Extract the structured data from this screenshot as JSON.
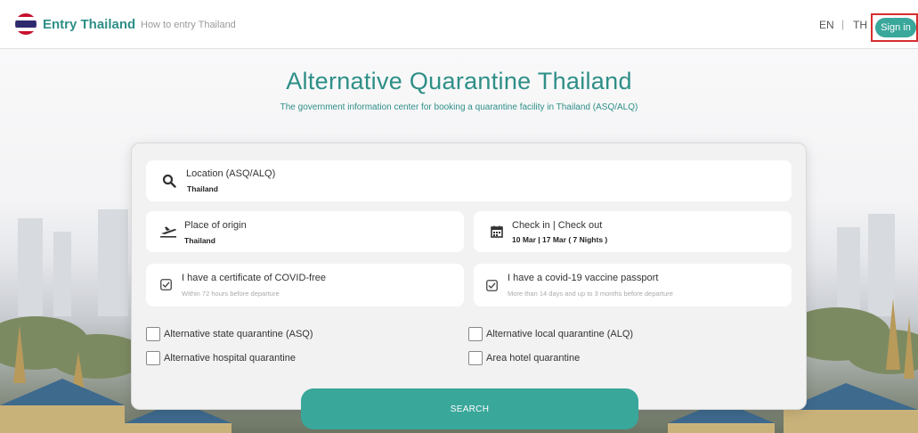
{
  "header": {
    "brand": "Entry Thailand",
    "tagline": "How to entry Thailand",
    "lang_en": "EN",
    "lang_sep": "|",
    "lang_th": "TH",
    "signin_label": "Sign in"
  },
  "hero": {
    "title": "Alternative Quarantine Thailand",
    "subtitle": "The government information center for booking a quarantine facility in Thailand (ASQ/ALQ)"
  },
  "form": {
    "location": {
      "label": "Location (ASQ/ALQ)",
      "value": "Thailand",
      "icon": "search-icon"
    },
    "origin": {
      "label": "Place of origin",
      "value": "Thailand",
      "icon": "plane-departure-icon"
    },
    "dates": {
      "label": "Check in | Check out",
      "value": "10 Mar | 17 Mar ( 7 Nights )",
      "icon": "calendar-icon"
    },
    "covid_cert": {
      "label": "I have a certificate of COVID-free",
      "hint": "Within 72 hours before departure",
      "icon": "checkbox-checked-icon"
    },
    "vaccine": {
      "label": "I have a covid-19 vaccine passport",
      "hint": "More than 14 days and up to 3 months before departure",
      "icon": "checkbox-checked-icon"
    },
    "options": [
      {
        "label": "Alternative state quarantine (ASQ)",
        "checked": false
      },
      {
        "label": "Alternative local quarantine (ALQ)",
        "checked": false
      },
      {
        "label": "Alternative hospital quarantine",
        "checked": false
      },
      {
        "label": "Area hotel quarantine",
        "checked": false
      }
    ],
    "search_label": "SEARCH"
  },
  "colors": {
    "accent": "#3aa79b",
    "brand_text": "#2e8f87",
    "highlight_frame": "#d62e2e"
  }
}
